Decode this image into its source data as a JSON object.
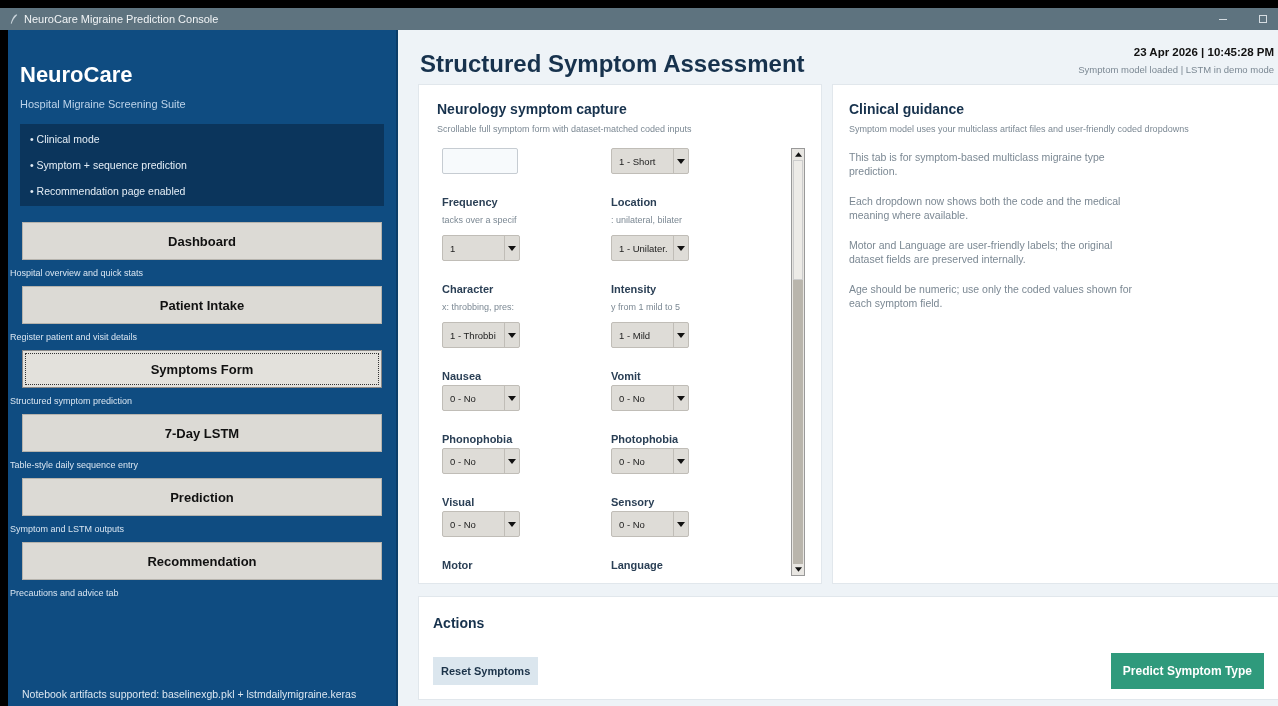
{
  "window": {
    "title": "NeuroCare Migraine Prediction Console"
  },
  "sidebar": {
    "brand": "NeuroCare",
    "subtitle": "Hospital Migraine Screening Suite",
    "features": [
      "• Clinical mode",
      "• Symptom + sequence prediction",
      "• Recommendation page enabled"
    ],
    "items": [
      {
        "label": "Dashboard",
        "caption": "Hospital overview and quick stats",
        "selected": false
      },
      {
        "label": "Patient Intake",
        "caption": "Register patient and visit details",
        "selected": false
      },
      {
        "label": "Symptoms Form",
        "caption": "Structured symptom prediction",
        "selected": true
      },
      {
        "label": "7-Day LSTM",
        "caption": "Table-style daily sequence entry",
        "selected": false
      },
      {
        "label": "Prediction",
        "caption": "Symptom and LSTM outputs",
        "selected": false
      },
      {
        "label": "Recommendation",
        "caption": "Precautions and advice tab",
        "selected": false
      }
    ],
    "footer": "Notebook artifacts supported: baselinexgb.pkl + lstmdailymigraine.keras"
  },
  "header": {
    "title": "Structured Symptom Assessment",
    "datetime": "23 Apr 2026 | 10:45:28 PM",
    "status": "Symptom model loaded | LSTM in demo mode"
  },
  "form": {
    "title": "Neurology symptom capture",
    "subtitle": "Scrollable full symptom form with dataset-matched coded inputs",
    "fields": [
      {
        "kind": "text"
      },
      {
        "kind": "select",
        "value": "1 - Short"
      },
      {
        "kind": "select",
        "label": "Frequency",
        "hint": "tacks over a specif",
        "value": "1"
      },
      {
        "kind": "select",
        "label": "Location",
        "hint": ": unilateral, bilater",
        "value": "1 - Unilater."
      },
      {
        "kind": "select",
        "label": "Character",
        "hint": "x: throbbing, pres:",
        "value": "1 - Throbbi"
      },
      {
        "kind": "select",
        "label": "Intensity",
        "hint": "y from 1 mild to 5",
        "value": "1 - Mild"
      },
      {
        "kind": "select",
        "label": "Nausea",
        "value": "0 - No"
      },
      {
        "kind": "select",
        "label": "Vomit",
        "value": "0 - No"
      },
      {
        "kind": "select",
        "label": "Phonophobia",
        "value": "0 - No"
      },
      {
        "kind": "select",
        "label": "Photophobia",
        "value": "0 - No"
      },
      {
        "kind": "select",
        "label": "Visual",
        "value": "0 - No"
      },
      {
        "kind": "select",
        "label": "Sensory",
        "value": "0 - No"
      },
      {
        "kind": "label",
        "label": "Motor"
      },
      {
        "kind": "label",
        "label": "Language"
      }
    ]
  },
  "guidance": {
    "title": "Clinical guidance",
    "subtitle": "Symptom model uses your multiclass artifact files and user-friendly coded dropdowns",
    "paragraphs": [
      "This tab is for symptom-based multiclass migraine type prediction.",
      "Each dropdown now shows both the code and the medical meaning where available.",
      "Motor and Language are user-friendly labels; the original dataset fields are preserved internally.",
      "Age should be numeric; use only the coded values shown for each symptom field."
    ]
  },
  "actions": {
    "title": "Actions",
    "buttons": [
      {
        "label": "Reset Symptoms",
        "kind": "secondary"
      },
      {
        "label": "Predict Symptom Type",
        "kind": "primary"
      }
    ]
  }
}
